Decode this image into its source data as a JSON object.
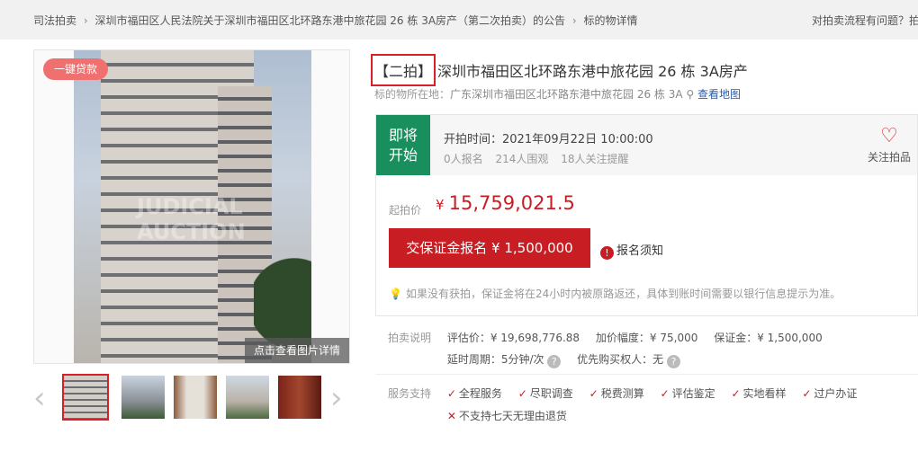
{
  "breadcrumb": {
    "items": [
      "司法拍卖",
      "深圳市福田区人民法院关于深圳市福田区北环路东港中旅花园 26 栋 3A房产（第二次拍卖）的公告",
      "标的物详情"
    ],
    "help": "对拍卖流程有问题？拍"
  },
  "gallery": {
    "badge": "一键贷款",
    "watermark": "JUDICIAL AUCTION",
    "view_details": "点击查看图片详情"
  },
  "listing": {
    "round_tag": "【二拍】",
    "title": "深圳市福田区北环路东港中旅花园 26 栋 3A房产",
    "location_label": "标的物所在地：",
    "location": "广东深圳市福田区北环路东港中旅花园 26 栋 3A",
    "map_link": "查看地图"
  },
  "auction": {
    "status": "即将开始",
    "start_time": "开拍时间：2021年09月22日 10:00:00",
    "signups": "0人报名",
    "viewers": "214人围观",
    "followers": "18人关注提醒",
    "follow_label": "关注拍品",
    "start_price_label": "起拍价",
    "currency": "¥",
    "start_price": "15,759,021.5",
    "deposit_button": "交保证金报名 ¥ 1,500,000",
    "notice": "报名须知",
    "refund_tip": "如果没有获拍，保证金将在24小时内被原路返还，具体到账时间需要以银行信息提示为准。"
  },
  "details": {
    "label": "拍卖说明",
    "appraisal": "评估价：¥ 19,698,776.88",
    "increment": "加价幅度：¥ 75,000",
    "deposit": "保证金：¥ 1,500,000",
    "delay": "延时周期：5分钟/次",
    "priority": "优先购买权人：无"
  },
  "services": {
    "label": "服务支持",
    "items": [
      "全程服务",
      "尽职调查",
      "税费测算",
      "评估鉴定",
      "实地看样",
      "过户办证"
    ],
    "excluded": "不支持七天无理由退货"
  },
  "colors": {
    "accent": "#c71d23",
    "status_green": "#1a8f5e",
    "link": "#2a5ca8"
  }
}
